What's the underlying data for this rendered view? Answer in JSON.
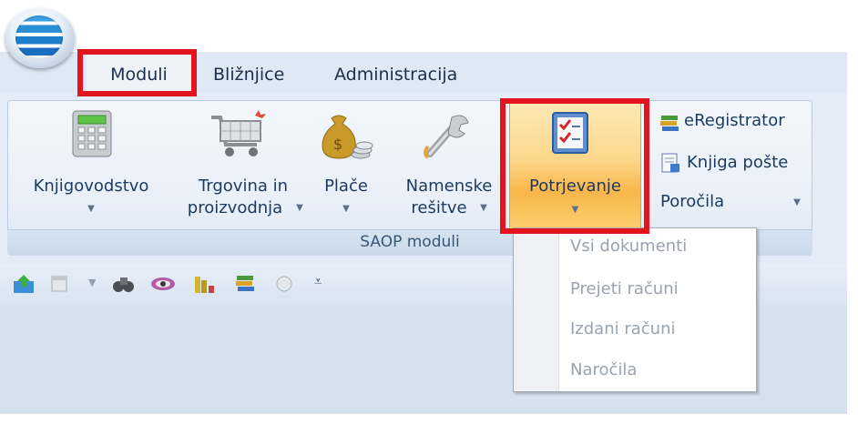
{
  "tabs": {
    "moduli": "Moduli",
    "bliznjice": "Bližnjice",
    "administracija": "Administracija"
  },
  "ribbon": {
    "group_label": "SAOP moduli",
    "knjigovodstvo": "Knjigovodstvo",
    "trgovina_line1": "Trgovina in",
    "trgovina_line2": "proizvodnja",
    "place": "Plače",
    "namenske_line1": "Namenske",
    "namenske_line2": "rešitve",
    "potrjevanje": "Potrjevanje",
    "eregistrator": "eRegistrator",
    "knjiga_poste": "Knjiga pošte",
    "porocila": "Poročila"
  },
  "dropdown": {
    "items": [
      "Vsi dokumenti",
      "Prejeti računi",
      "Izdani računi",
      "Naročila"
    ]
  },
  "colors": {
    "highlight": "#e2141e",
    "ribbon_bg": "#e3ecf7",
    "active_orange": "#f9b64a"
  }
}
